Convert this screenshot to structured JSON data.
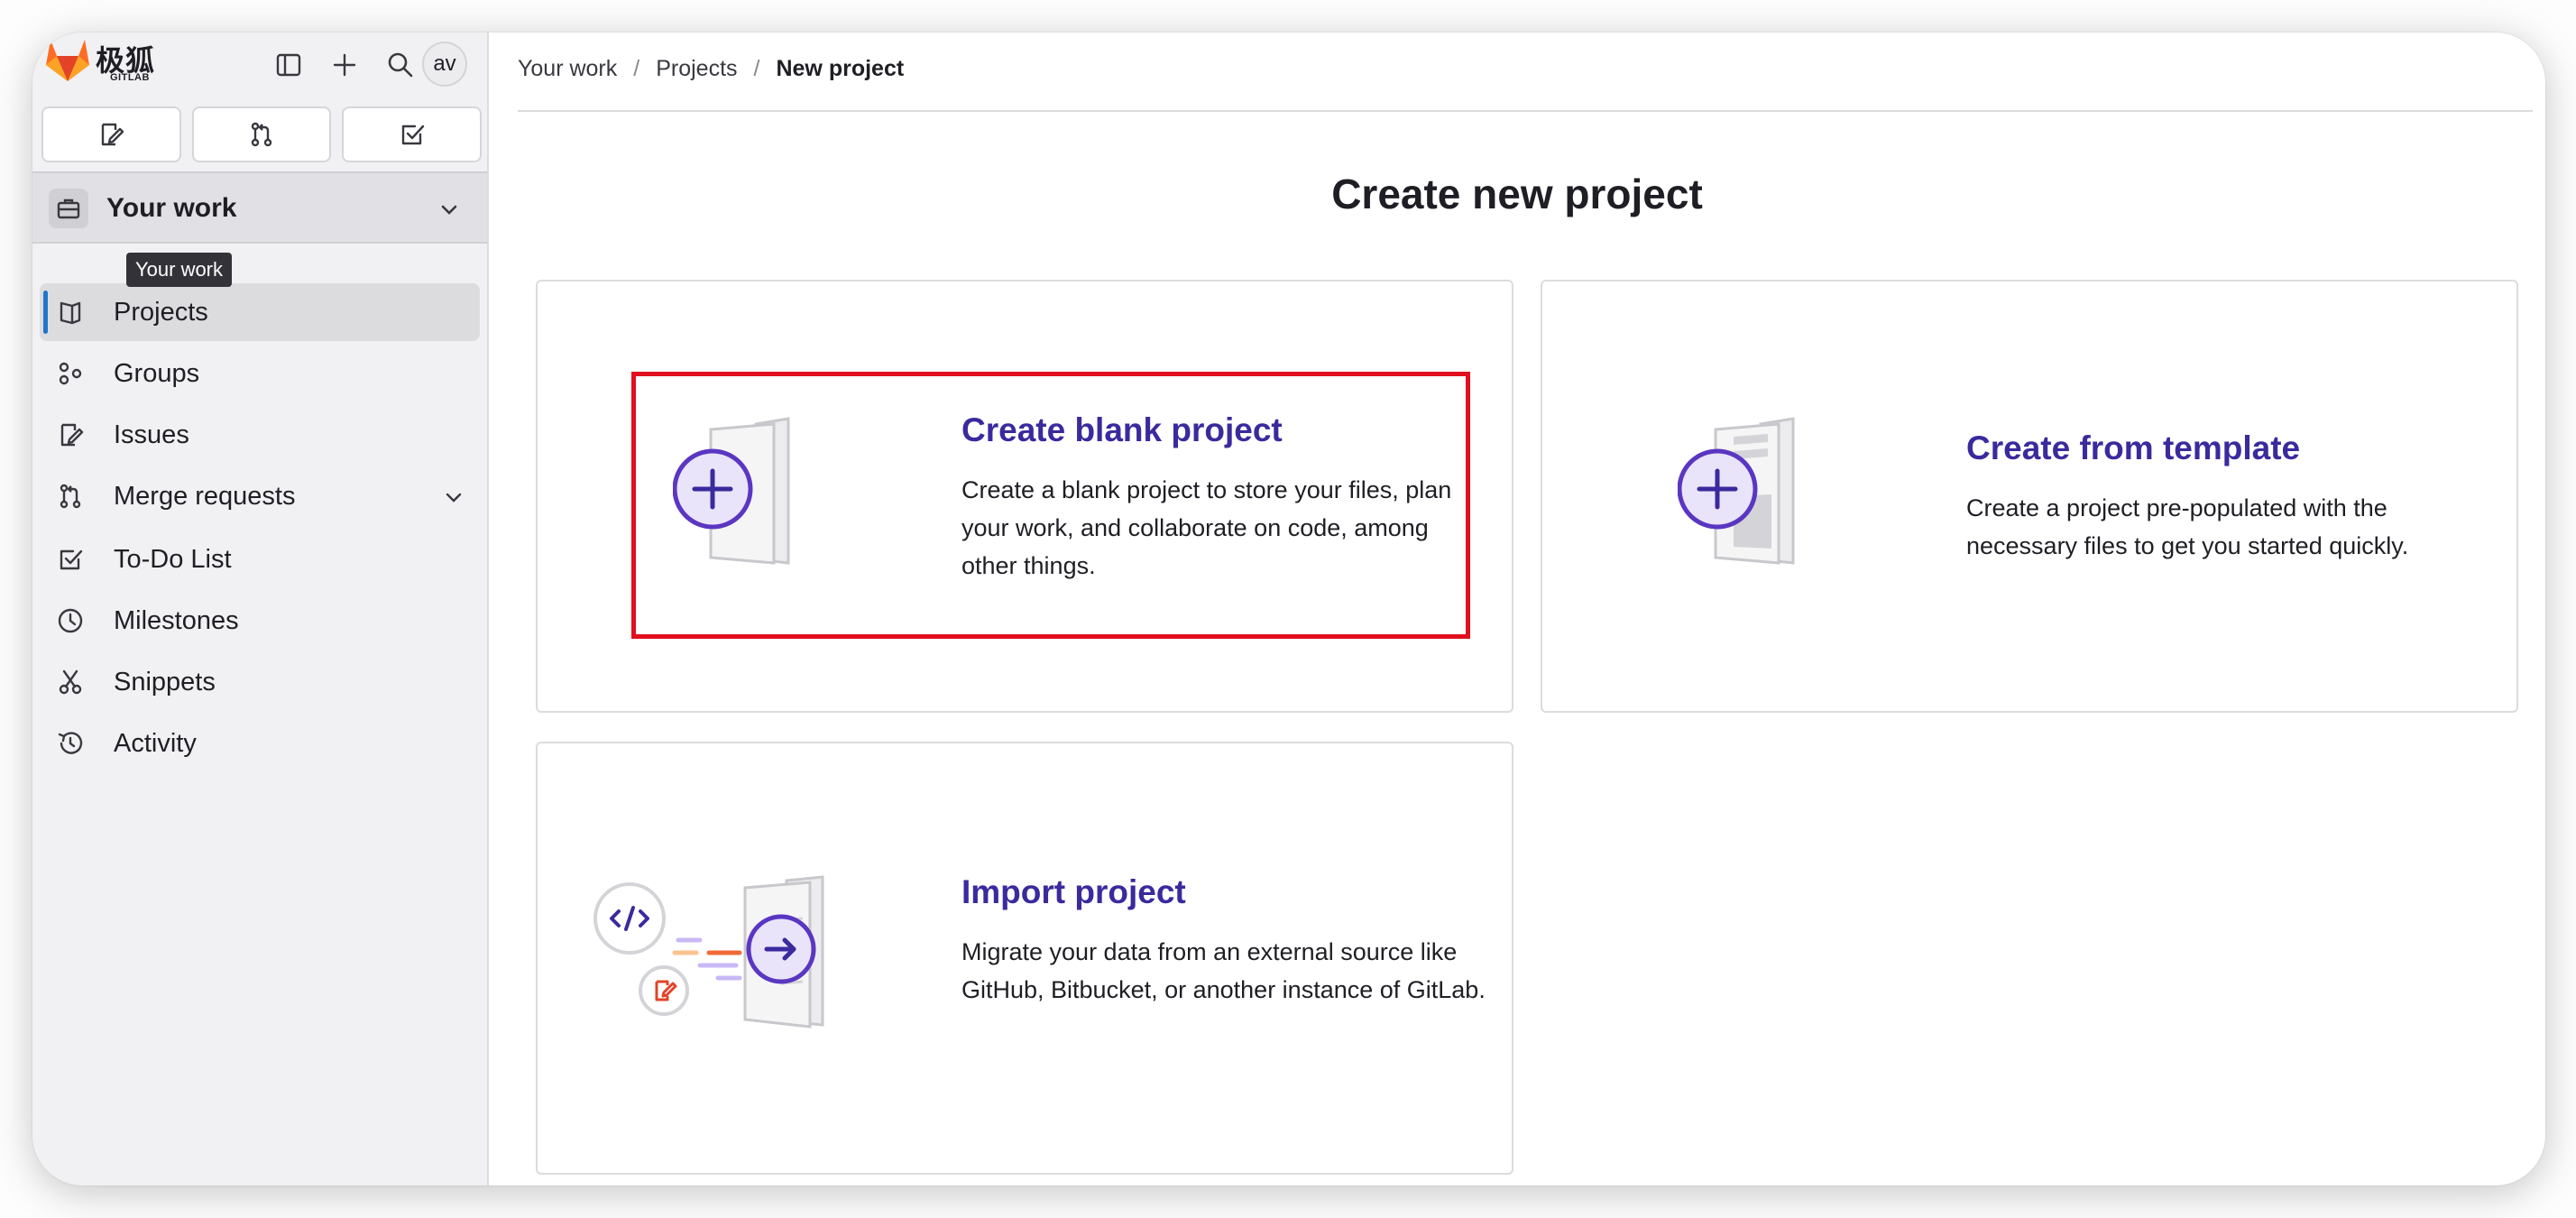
{
  "app": {
    "brand_name": "极狐",
    "brand_sub": "GITLAB",
    "avatar_initials": "av"
  },
  "sidebar": {
    "section_title": "Your work",
    "tooltip": "Your work",
    "items": [
      {
        "label": "Projects",
        "icon": "project-icon"
      },
      {
        "label": "Groups",
        "icon": "group-icon"
      },
      {
        "label": "Issues",
        "icon": "issues-icon"
      },
      {
        "label": "Merge requests",
        "icon": "merge-request-icon"
      },
      {
        "label": "To-Do List",
        "icon": "todo-icon"
      },
      {
        "label": "Milestones",
        "icon": "milestone-icon"
      },
      {
        "label": "Snippets",
        "icon": "snippet-icon"
      },
      {
        "label": "Activity",
        "icon": "activity-icon"
      }
    ]
  },
  "breadcrumb": {
    "items": [
      "Your work",
      "Projects",
      "New project"
    ],
    "separator": "/"
  },
  "main": {
    "title": "Create new project",
    "cards": [
      {
        "title": "Create blank project",
        "description": "Create a blank project to store your files, plan your work, and collaborate on code, among other things."
      },
      {
        "title": "Create from template",
        "description": "Create a project pre-populated with the necessary files to get you started quickly."
      },
      {
        "title": "Import project",
        "description": "Migrate your data from an external source like GitHub, Bitbucket, or another instance of GitLab."
      }
    ]
  },
  "colors": {
    "accent_purple": "#3a2a9e",
    "active_indicator": "#1f75cb",
    "highlight_red": "#e0101e",
    "logo_orange": "#e24329"
  }
}
